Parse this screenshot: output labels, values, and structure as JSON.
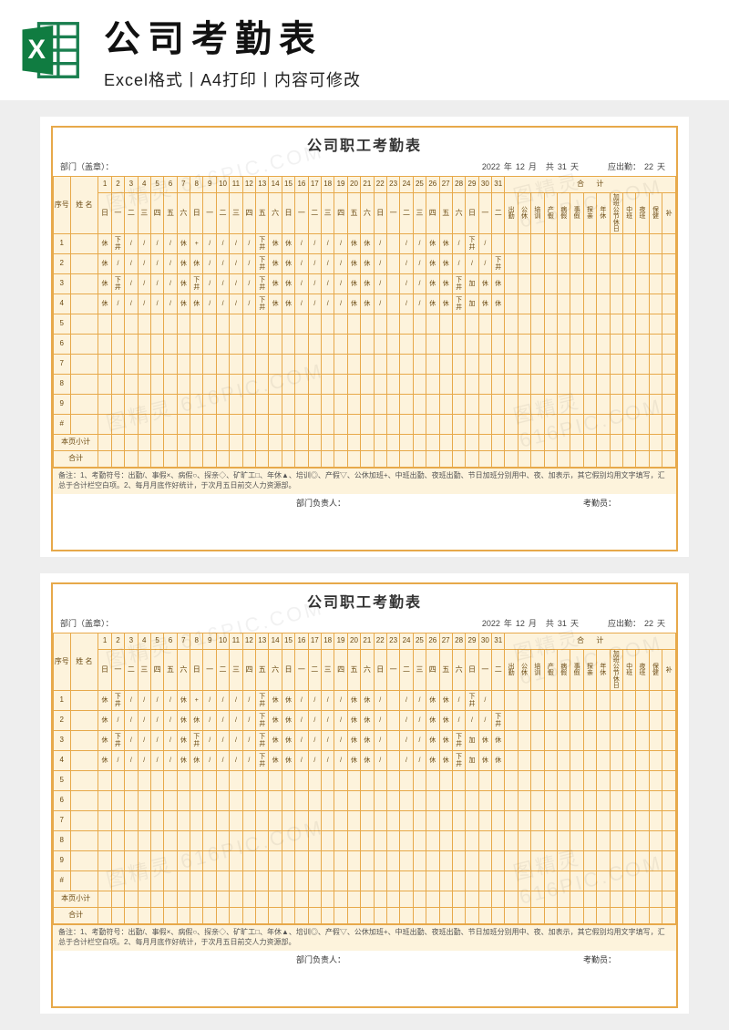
{
  "header": {
    "main_title": "公司考勤表",
    "subtitle": "Excel格式丨A4打印丨内容可修改"
  },
  "sheet_title": "公司职工考勤表",
  "meta": {
    "dept_label": "部门（盖章）：",
    "year": "2022",
    "year_suffix": "年",
    "month": "12",
    "month_suffix": "月",
    "total_prefix": "共",
    "total_days": "31",
    "days_unit": "天",
    "should_label": "应出勤：",
    "should_days": "22",
    "should_unit": "天"
  },
  "table": {
    "seq_label": "序号",
    "name_label": "姓 名",
    "days": [
      "1",
      "2",
      "3",
      "4",
      "5",
      "6",
      "7",
      "8",
      "9",
      "10",
      "11",
      "12",
      "13",
      "14",
      "15",
      "16",
      "17",
      "18",
      "19",
      "20",
      "21",
      "22",
      "23",
      "24",
      "25",
      "26",
      "27",
      "28",
      "29",
      "30",
      "31"
    ],
    "weekdays": [
      "日",
      "一",
      "二",
      "三",
      "四",
      "五",
      "六",
      "日",
      "一",
      "二",
      "三",
      "四",
      "五",
      "六",
      "日",
      "一",
      "二",
      "三",
      "四",
      "五",
      "六",
      "日",
      "一",
      "二",
      "三",
      "四",
      "五",
      "六",
      "日",
      "一",
      "二"
    ],
    "summary_group1": "合",
    "summary_group2": "计",
    "summary_cols": [
      "出勤",
      "公休",
      "培训",
      "产假",
      "病假",
      "事假",
      "探亲",
      "年休",
      "加班公节休日",
      "中班",
      "夜班",
      "保健",
      "补"
    ],
    "rows_numbers": [
      "1",
      "2",
      "3",
      "4",
      "5",
      "6",
      "7",
      "8",
      "9",
      "#"
    ],
    "row_data": [
      [
        "休",
        "下井",
        "/",
        "/",
        "/",
        "/",
        "休",
        "+",
        "/",
        "/",
        "/",
        "/",
        "下井",
        "休",
        "休",
        "/",
        "/",
        "/",
        "/",
        "休",
        "休",
        "/",
        "",
        "/",
        "/",
        "休",
        "休",
        "/",
        "下井",
        "/",
        ""
      ],
      [
        "休",
        "/",
        "/",
        "/",
        "/",
        "/",
        "休",
        "休",
        "/",
        "/",
        "/",
        "/",
        "下井",
        "休",
        "休",
        "/",
        "/",
        "/",
        "/",
        "休",
        "休",
        "/",
        "",
        "/",
        "/",
        "休",
        "休",
        "/",
        "/",
        "/",
        "下井"
      ],
      [
        "休",
        "下井",
        "/",
        "/",
        "/",
        "/",
        "休",
        "下井",
        "/",
        "/",
        "/",
        "/",
        "下井",
        "休",
        "休",
        "/",
        "/",
        "/",
        "/",
        "休",
        "休",
        "/",
        "",
        "/",
        "/",
        "休",
        "休",
        "下井",
        "加",
        "休",
        "休",
        "/"
      ],
      [
        "休",
        "/",
        "/",
        "/",
        "/",
        "/",
        "休",
        "休",
        "/",
        "/",
        "/",
        "/",
        "下井",
        "休",
        "休",
        "/",
        "/",
        "/",
        "/",
        "休",
        "休",
        "/",
        "",
        "/",
        "/",
        "休",
        "休",
        "下井",
        "加",
        "休",
        "休",
        "/"
      ],
      [
        "",
        "",
        "",
        "",
        "",
        "",
        "",
        "",
        "",
        "",
        "",
        "",
        "",
        "",
        "",
        "",
        "",
        "",
        "",
        "",
        "",
        "",
        "",
        "",
        "",
        "",
        "",
        "",
        "",
        "",
        ""
      ],
      [
        "",
        "",
        "",
        "",
        "",
        "",
        "",
        "",
        "",
        "",
        "",
        "",
        "",
        "",
        "",
        "",
        "",
        "",
        "",
        "",
        "",
        "",
        "",
        "",
        "",
        "",
        "",
        "",
        "",
        "",
        ""
      ],
      [
        "",
        "",
        "",
        "",
        "",
        "",
        "",
        "",
        "",
        "",
        "",
        "",
        "",
        "",
        "",
        "",
        "",
        "",
        "",
        "",
        "",
        "",
        "",
        "",
        "",
        "",
        "",
        "",
        "",
        "",
        ""
      ],
      [
        "",
        "",
        "",
        "",
        "",
        "",
        "",
        "",
        "",
        "",
        "",
        "",
        "",
        "",
        "",
        "",
        "",
        "",
        "",
        "",
        "",
        "",
        "",
        "",
        "",
        "",
        "",
        "",
        "",
        "",
        ""
      ],
      [
        "",
        "",
        "",
        "",
        "",
        "",
        "",
        "",
        "",
        "",
        "",
        "",
        "",
        "",
        "",
        "",
        "",
        "",
        "",
        "",
        "",
        "",
        "",
        "",
        "",
        "",
        "",
        "",
        "",
        "",
        ""
      ],
      [
        "",
        "",
        "",
        "",
        "",
        "",
        "",
        "",
        "",
        "",
        "",
        "",
        "",
        "",
        "",
        "",
        "",
        "",
        "",
        "",
        "",
        "",
        "",
        "",
        "",
        "",
        "",
        "",
        "",
        "",
        ""
      ]
    ],
    "subtotal_label": "本页小计",
    "total_label": "合计"
  },
  "notes_text": "备注：1、考勤符号：出勤/、事假×、病假○、探亲◇、矿旷工□、年休▲、培训◎、产假▽、公休加班+、中班出勤、夜班出勤、节日加班分别用中、夜、加表示，其它假别均用文字填写，汇总于合计栏空白项。2、每月月底作好统计，于次月五日前交人力资源部。",
  "sign": {
    "leader": "部门负责人：",
    "clerk": "考勤员："
  },
  "watermark": "图精灵 616PIC.COM"
}
